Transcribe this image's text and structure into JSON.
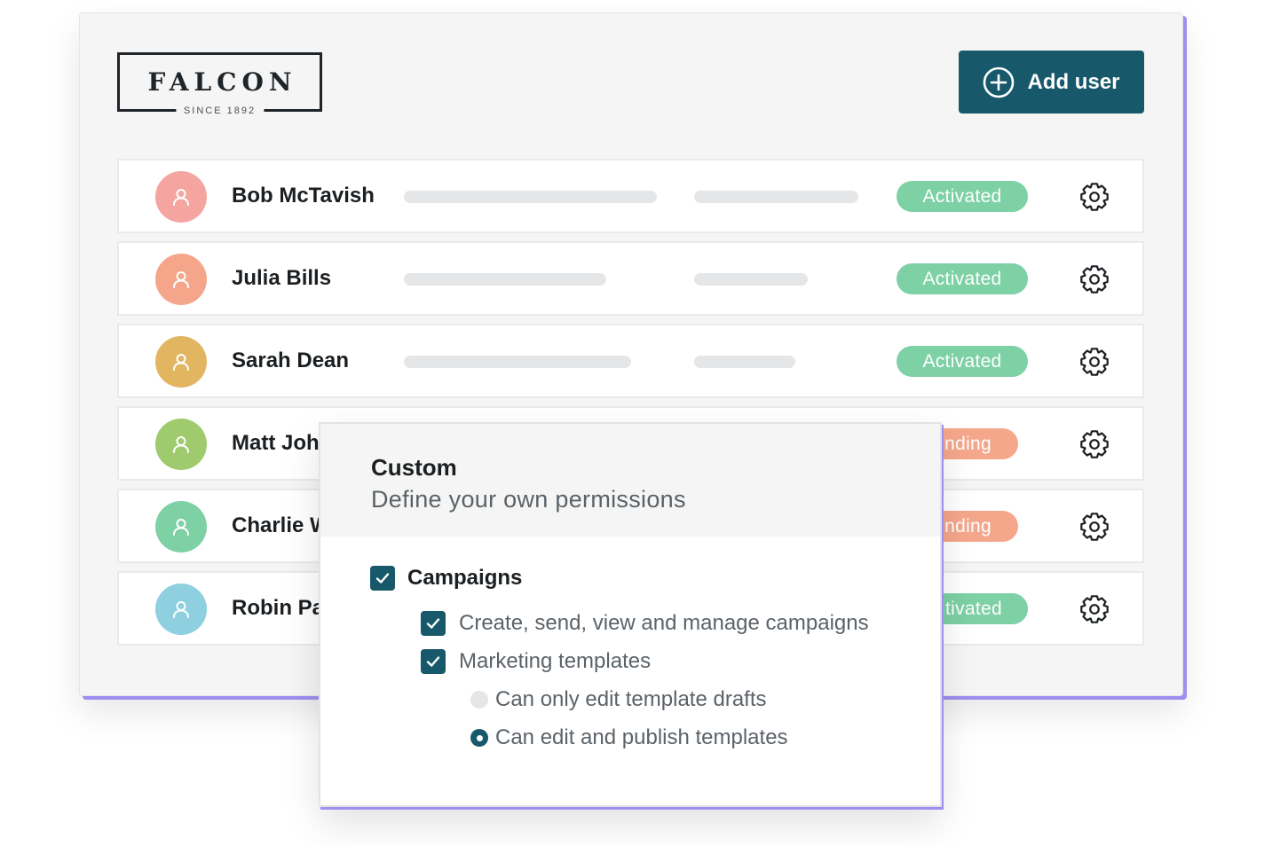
{
  "brand": {
    "name": "FALCON",
    "tagline": "SINCE 1892"
  },
  "header": {
    "add_user_label": "Add user"
  },
  "colors": {
    "primary": "#17596a",
    "activated": "#7ed0a5",
    "pending": "#f5a78c",
    "accent_shadow": "#9c8ff0"
  },
  "users": [
    {
      "name": "Bob McTavish",
      "status": "Activated",
      "avatar_color": "#f5a5a0",
      "status_color": "#7ed0a5"
    },
    {
      "name": "Julia Bills",
      "status": "Activated",
      "avatar_color": "#f5a58a",
      "status_color": "#7ed0a5"
    },
    {
      "name": "Sarah Dean",
      "status": "Activated",
      "avatar_color": "#e2b661",
      "status_color": "#7ed0a5"
    },
    {
      "name": "Matt Joh",
      "status": "nding",
      "avatar_color": "#9fcb6e",
      "status_color": "#f5a78c"
    },
    {
      "name": "Charlie W",
      "status": "nding",
      "avatar_color": "#7ed0a5",
      "status_color": "#f5a78c"
    },
    {
      "name": "Robin Pa",
      "status": "tivated",
      "avatar_color": "#8ecfe0",
      "status_color": "#7ed0a5"
    }
  ],
  "permissions": {
    "title": "Custom",
    "subtitle": "Define your own permissions",
    "campaigns": {
      "label": "Campaigns",
      "checked": true
    },
    "create_send": {
      "label": "Create, send, view and manage campaigns",
      "checked": true
    },
    "marketing_templates": {
      "label": "Marketing templates",
      "checked": true
    },
    "drafts_only": {
      "label": "Can only edit template drafts",
      "selected": false
    },
    "edit_publish": {
      "label": "Can edit and publish templates",
      "selected": true
    }
  }
}
